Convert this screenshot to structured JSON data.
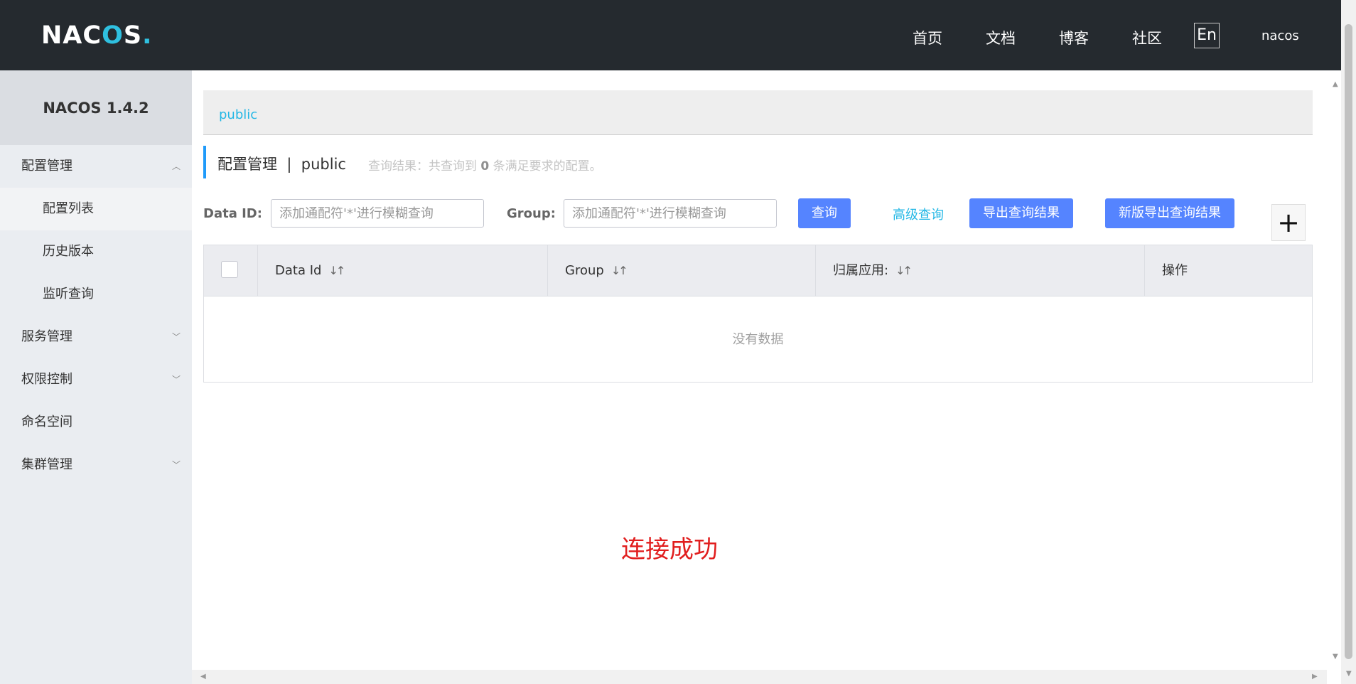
{
  "header": {
    "logo": {
      "part1": "NAC",
      "part2": "O",
      "part3": "S",
      "dot": "."
    },
    "nav": [
      "首页",
      "文档",
      "博客",
      "社区"
    ],
    "lang": "En",
    "user": "nacos"
  },
  "sidebar": {
    "title": "NACOS 1.4.2",
    "items": [
      {
        "label": "配置管理"
      },
      {
        "label": "配置列表"
      },
      {
        "label": "历史版本"
      },
      {
        "label": "监听查询"
      },
      {
        "label": "服务管理"
      },
      {
        "label": "权限控制"
      },
      {
        "label": "命名空间"
      },
      {
        "label": "集群管理"
      }
    ]
  },
  "namespace": {
    "current": "public"
  },
  "page": {
    "title": "配置管理",
    "sep": "|",
    "ns": "public",
    "result_prefix": "查询结果：共查询到",
    "result_count": "0",
    "result_suffix": "条满足要求的配置。"
  },
  "search": {
    "dataid_label": "Data ID:",
    "dataid_placeholder": "添加通配符'*'进行模糊查询",
    "group_label": "Group:",
    "group_placeholder": "添加通配符'*'进行模糊查询",
    "query_btn": "查询",
    "advanced": "高级查询",
    "export_btn": "导出查询结果",
    "export_new_btn": "新版导出查询结果",
    "add_symbol": "+"
  },
  "table": {
    "columns": [
      "Data Id",
      "Group",
      "归属应用:",
      "操作"
    ],
    "empty": "没有数据"
  },
  "message": "连接成功",
  "colors": {
    "topbar": "#252a2f",
    "accent": "#5584ff",
    "link": "#23b7e5",
    "success": "#e11e1e"
  }
}
